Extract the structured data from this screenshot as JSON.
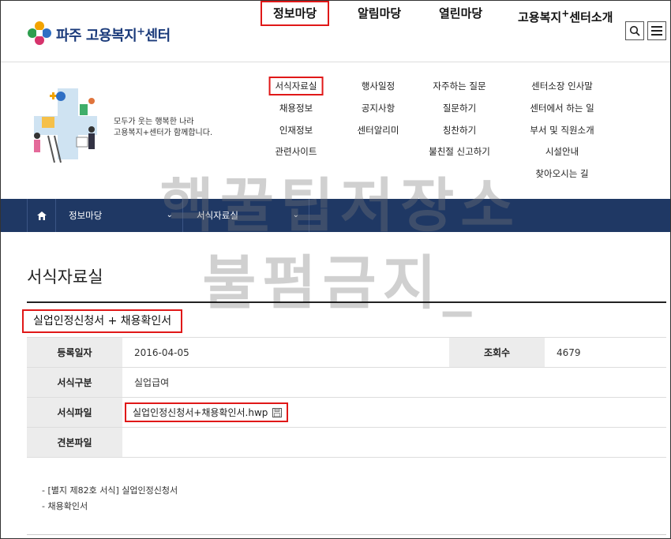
{
  "logo": {
    "text": "파주 고용복지",
    "sup": "+",
    "suffix": "센터"
  },
  "nav": {
    "items": [
      {
        "label": "정보마당",
        "sup": "",
        "suffix": "",
        "active": true
      },
      {
        "label": "알림마당",
        "sup": "",
        "suffix": "",
        "active": false
      },
      {
        "label": "열린마당",
        "sup": "",
        "suffix": "",
        "active": false
      },
      {
        "label": "고용복지",
        "sup": "+",
        "suffix": "센터소개",
        "active": false
      }
    ]
  },
  "slogan": {
    "line1": "모두가 웃는 행복한 나라",
    "line2": "고용복지+센터가 함께합니다."
  },
  "mega_menu": {
    "col1": [
      "서식자료실",
      "채용정보",
      "인재정보",
      "관련사이트"
    ],
    "col2": [
      "행사일정",
      "공지사항",
      "센터알리미"
    ],
    "col3": [
      "자주하는 질문",
      "질문하기",
      "칭찬하기",
      "불친절 신고하기"
    ],
    "col4": [
      "센터소장 인사말",
      "센터에서 하는 일",
      "부서 및 직원소개",
      "시설안내",
      "찾아오시는 길"
    ]
  },
  "breadcrumb": {
    "level1": "정보마당",
    "level2": "서식자료실"
  },
  "watermark": {
    "line1": "핵꿀팁저장소",
    "line2": "불펌금지_"
  },
  "page_title": "서식자료실",
  "doc_title": "실업인정신청서 + 채용확인서",
  "info": {
    "reg_date_label": "등록일자",
    "reg_date": "2016-04-05",
    "views_label": "조회수",
    "views": "4679",
    "category_label": "서식구분",
    "category": "실업급여",
    "file_label": "서식파일",
    "file_name": "실업인정신청서+채용확인서.hwp",
    "sample_label": "견본파일",
    "sample": ""
  },
  "notes": [
    "- [별지 제82호 서식] 실업인정신청서",
    "- 채용확인서"
  ],
  "colors": {
    "navy": "#1f3864",
    "highlight": "#e01818",
    "logo": "#1a3a7a"
  },
  "icons": [
    "logo-icon",
    "search-icon",
    "menu-icon",
    "home-icon",
    "chevron-down-icon",
    "file-save-icon"
  ]
}
